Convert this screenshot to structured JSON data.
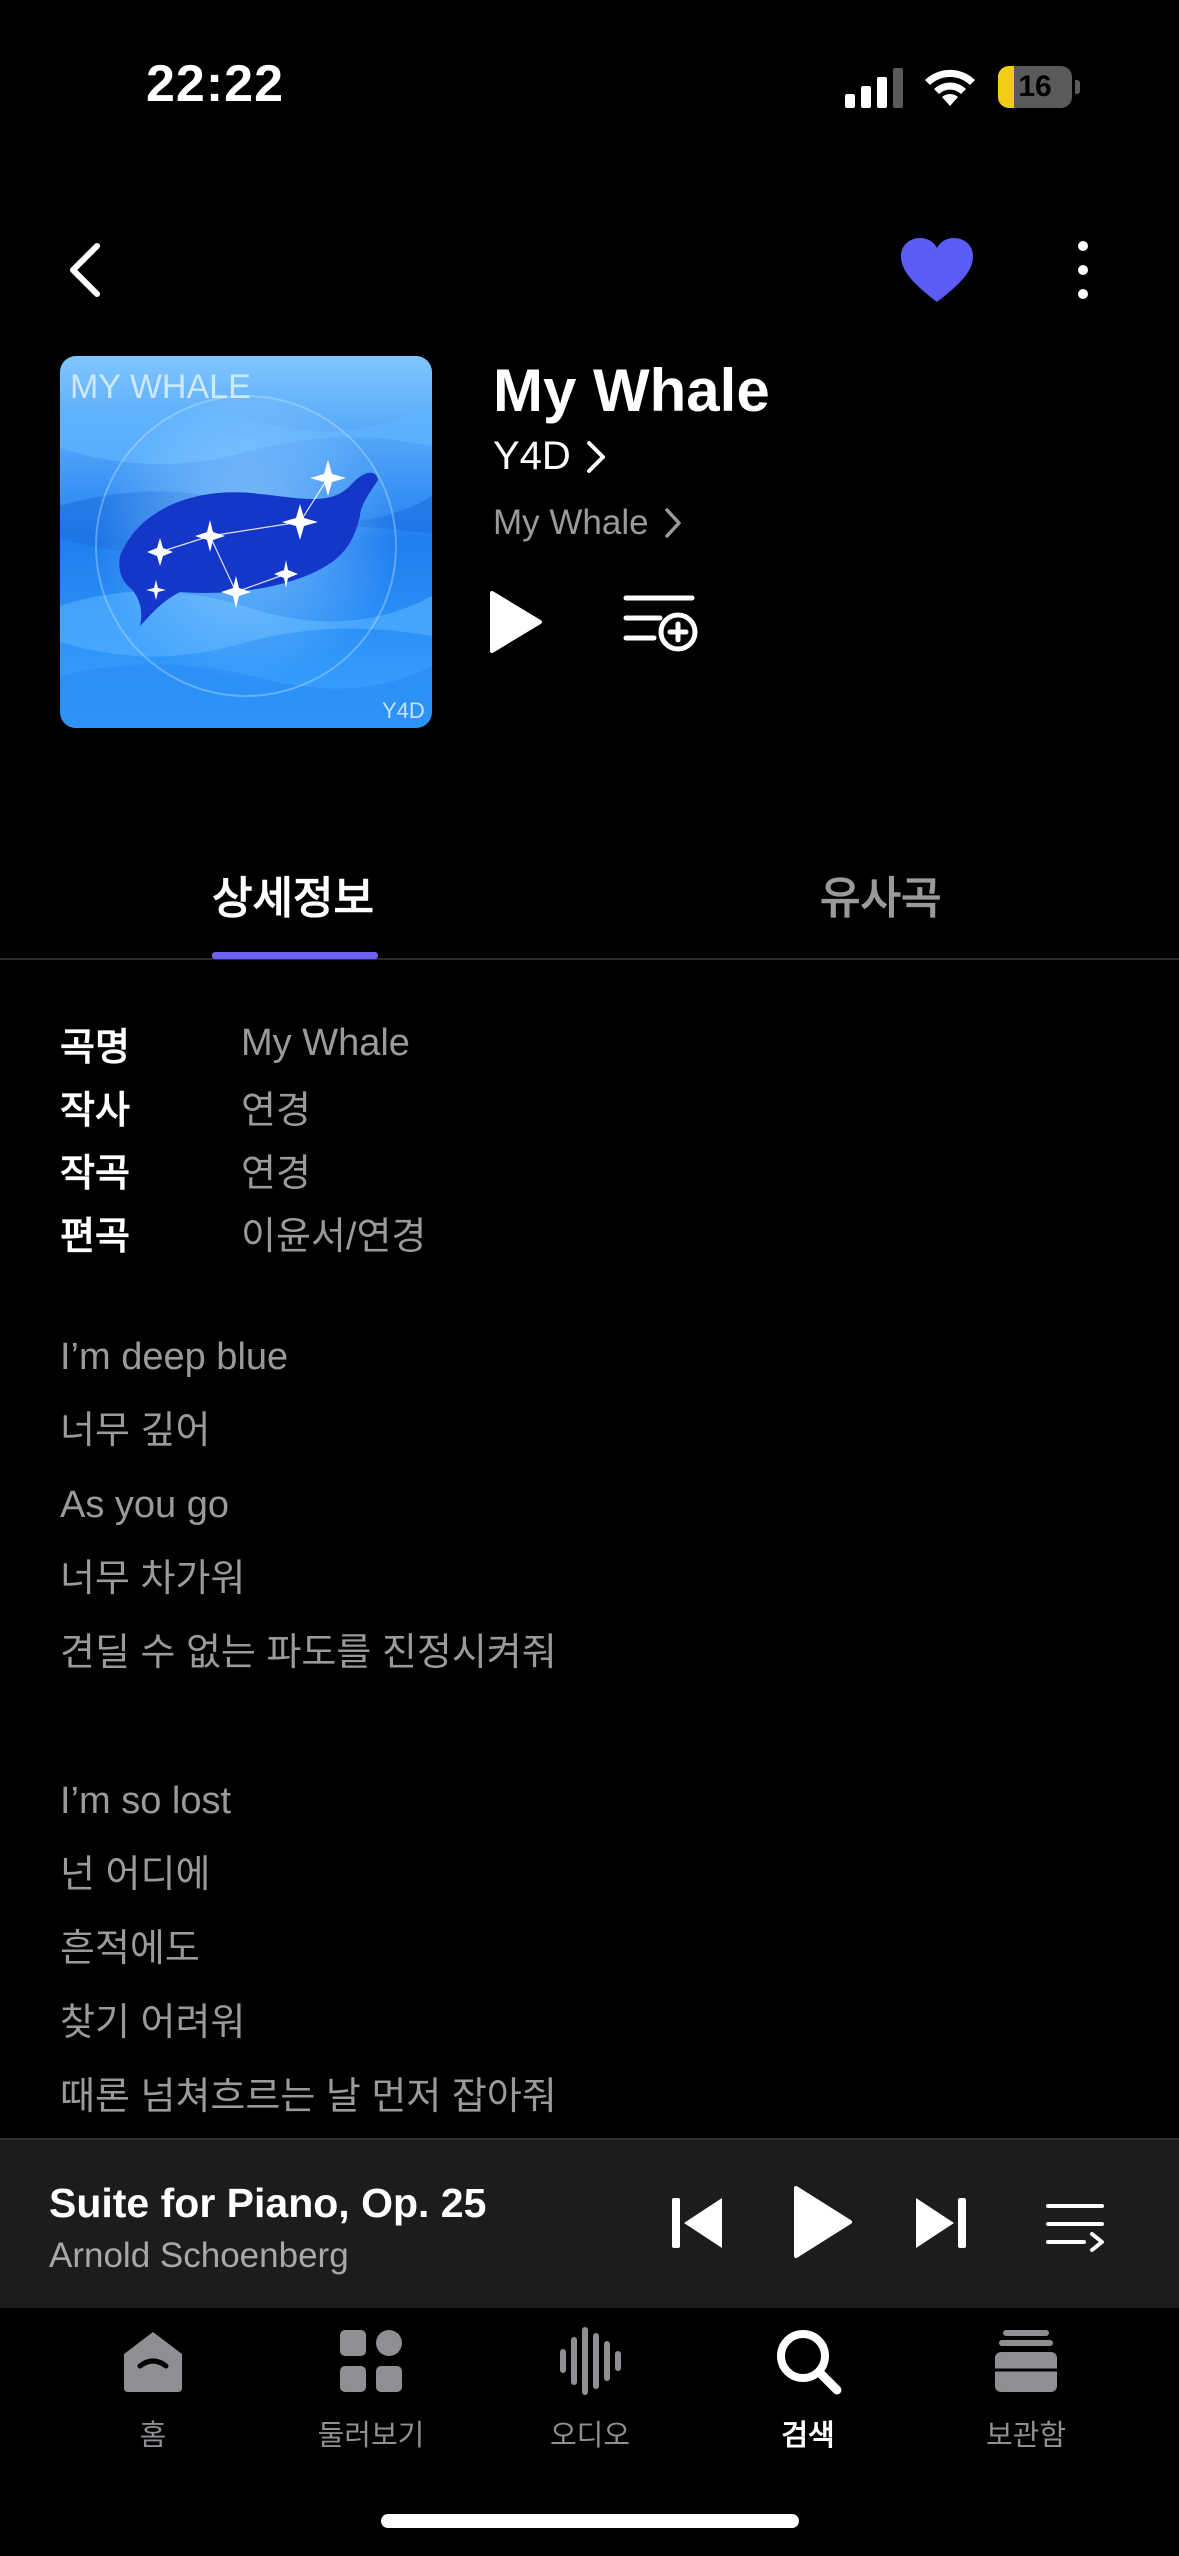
{
  "status_bar": {
    "time": "22:22",
    "battery_level": "16"
  },
  "header": {
    "back_icon": "chevron-left-icon",
    "like_icon": "heart-icon",
    "like_color": "#5b5bf5",
    "more_icon": "more-vertical-icon"
  },
  "song": {
    "title": "My Whale",
    "artist": "Y4D",
    "album": "My Whale",
    "album_art_text": "MY WHALE",
    "album_art_signature": "Y4D"
  },
  "tabs": [
    {
      "label": "상세정보",
      "active": true
    },
    {
      "label": "유사곡",
      "active": false
    }
  ],
  "accent_color": "#6b62ee",
  "info": [
    {
      "key": "곡명",
      "value": "My Whale"
    },
    {
      "key": "작사",
      "value": "연경"
    },
    {
      "key": "작곡",
      "value": "연경"
    },
    {
      "key": "편곡",
      "value": "이윤서/연경"
    }
  ],
  "lyrics": [
    "I’m deep blue",
    "너무 깊어",
    "As you go",
    "너무 차가워",
    "견딜 수 없는 파도를 진정시켜줘",
    "",
    "I’m so lost",
    "넌 어디에",
    "흔적에도",
    "찾기 어려워",
    "때론 넘쳐흐르는 날 먼저 잡아줘"
  ],
  "now_playing": {
    "title": "Suite for Piano, Op. 25",
    "artist": "Arnold Schoenberg"
  },
  "tab_bar": [
    {
      "label": "홈",
      "icon": "home-icon",
      "active": false
    },
    {
      "label": "둘러보기",
      "icon": "browse-grid-icon",
      "active": false
    },
    {
      "label": "오디오",
      "icon": "audio-waveform-icon",
      "active": false
    },
    {
      "label": "검색",
      "icon": "search-icon",
      "active": true
    },
    {
      "label": "보관함",
      "icon": "library-icon",
      "active": false
    }
  ]
}
